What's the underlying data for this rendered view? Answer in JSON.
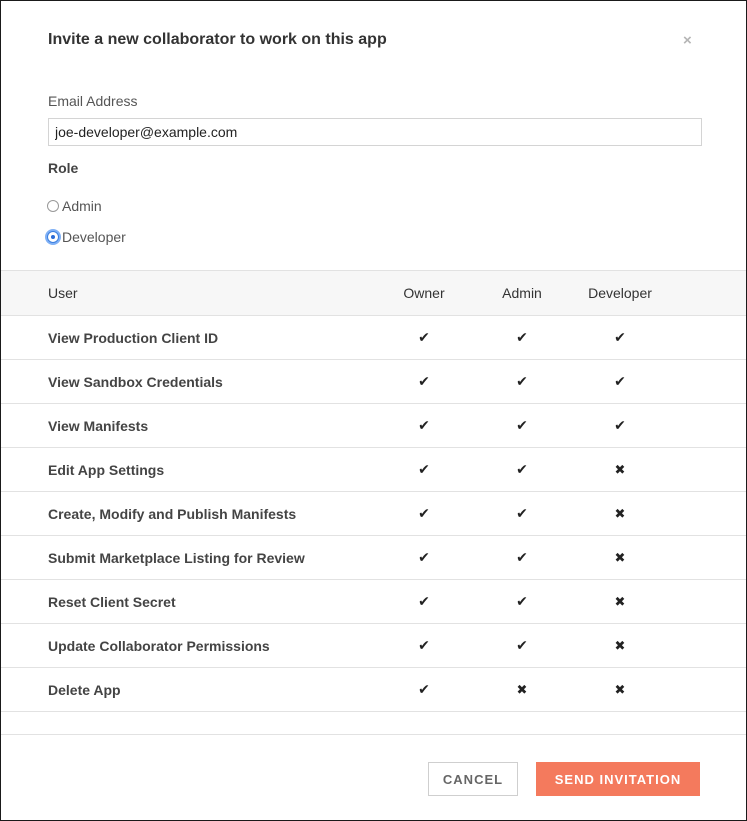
{
  "dialog": {
    "title": "Invite a new collaborator to work on this app",
    "close_glyph": "×"
  },
  "form": {
    "email_label": "Email Address",
    "email_value": "joe-developer@example.com",
    "role_label": "Role",
    "roles": [
      {
        "label": "Admin",
        "selected": false
      },
      {
        "label": "Developer",
        "selected": true
      }
    ]
  },
  "table": {
    "headers": {
      "user": "User",
      "owner": "Owner",
      "admin": "Admin",
      "developer": "Developer"
    },
    "rows": [
      {
        "name": "View Production Client ID",
        "owner": "✔",
        "admin": "✔",
        "developer": "✔"
      },
      {
        "name": "View Sandbox Credentials",
        "owner": "✔",
        "admin": "✔",
        "developer": "✔"
      },
      {
        "name": "View Manifests",
        "owner": "✔",
        "admin": "✔",
        "developer": "✔"
      },
      {
        "name": "Edit App Settings",
        "owner": "✔",
        "admin": "✔",
        "developer": "✖"
      },
      {
        "name": "Create, Modify and Publish Manifests",
        "owner": "✔",
        "admin": "✔",
        "developer": "✖"
      },
      {
        "name": "Submit Marketplace Listing for Review",
        "owner": "✔",
        "admin": "✔",
        "developer": "✖"
      },
      {
        "name": "Reset Client Secret",
        "owner": "✔",
        "admin": "✔",
        "developer": "✖"
      },
      {
        "name": "Update Collaborator Permissions",
        "owner": "✔",
        "admin": "✔",
        "developer": "✖"
      },
      {
        "name": "Delete App",
        "owner": "✔",
        "admin": "✖",
        "developer": "✖"
      }
    ]
  },
  "footer": {
    "cancel_label": "CANCEL",
    "send_label": "SEND INVITATION"
  },
  "colors": {
    "accent": "#f47a5d",
    "radio_focus": "#3b7fe0"
  }
}
